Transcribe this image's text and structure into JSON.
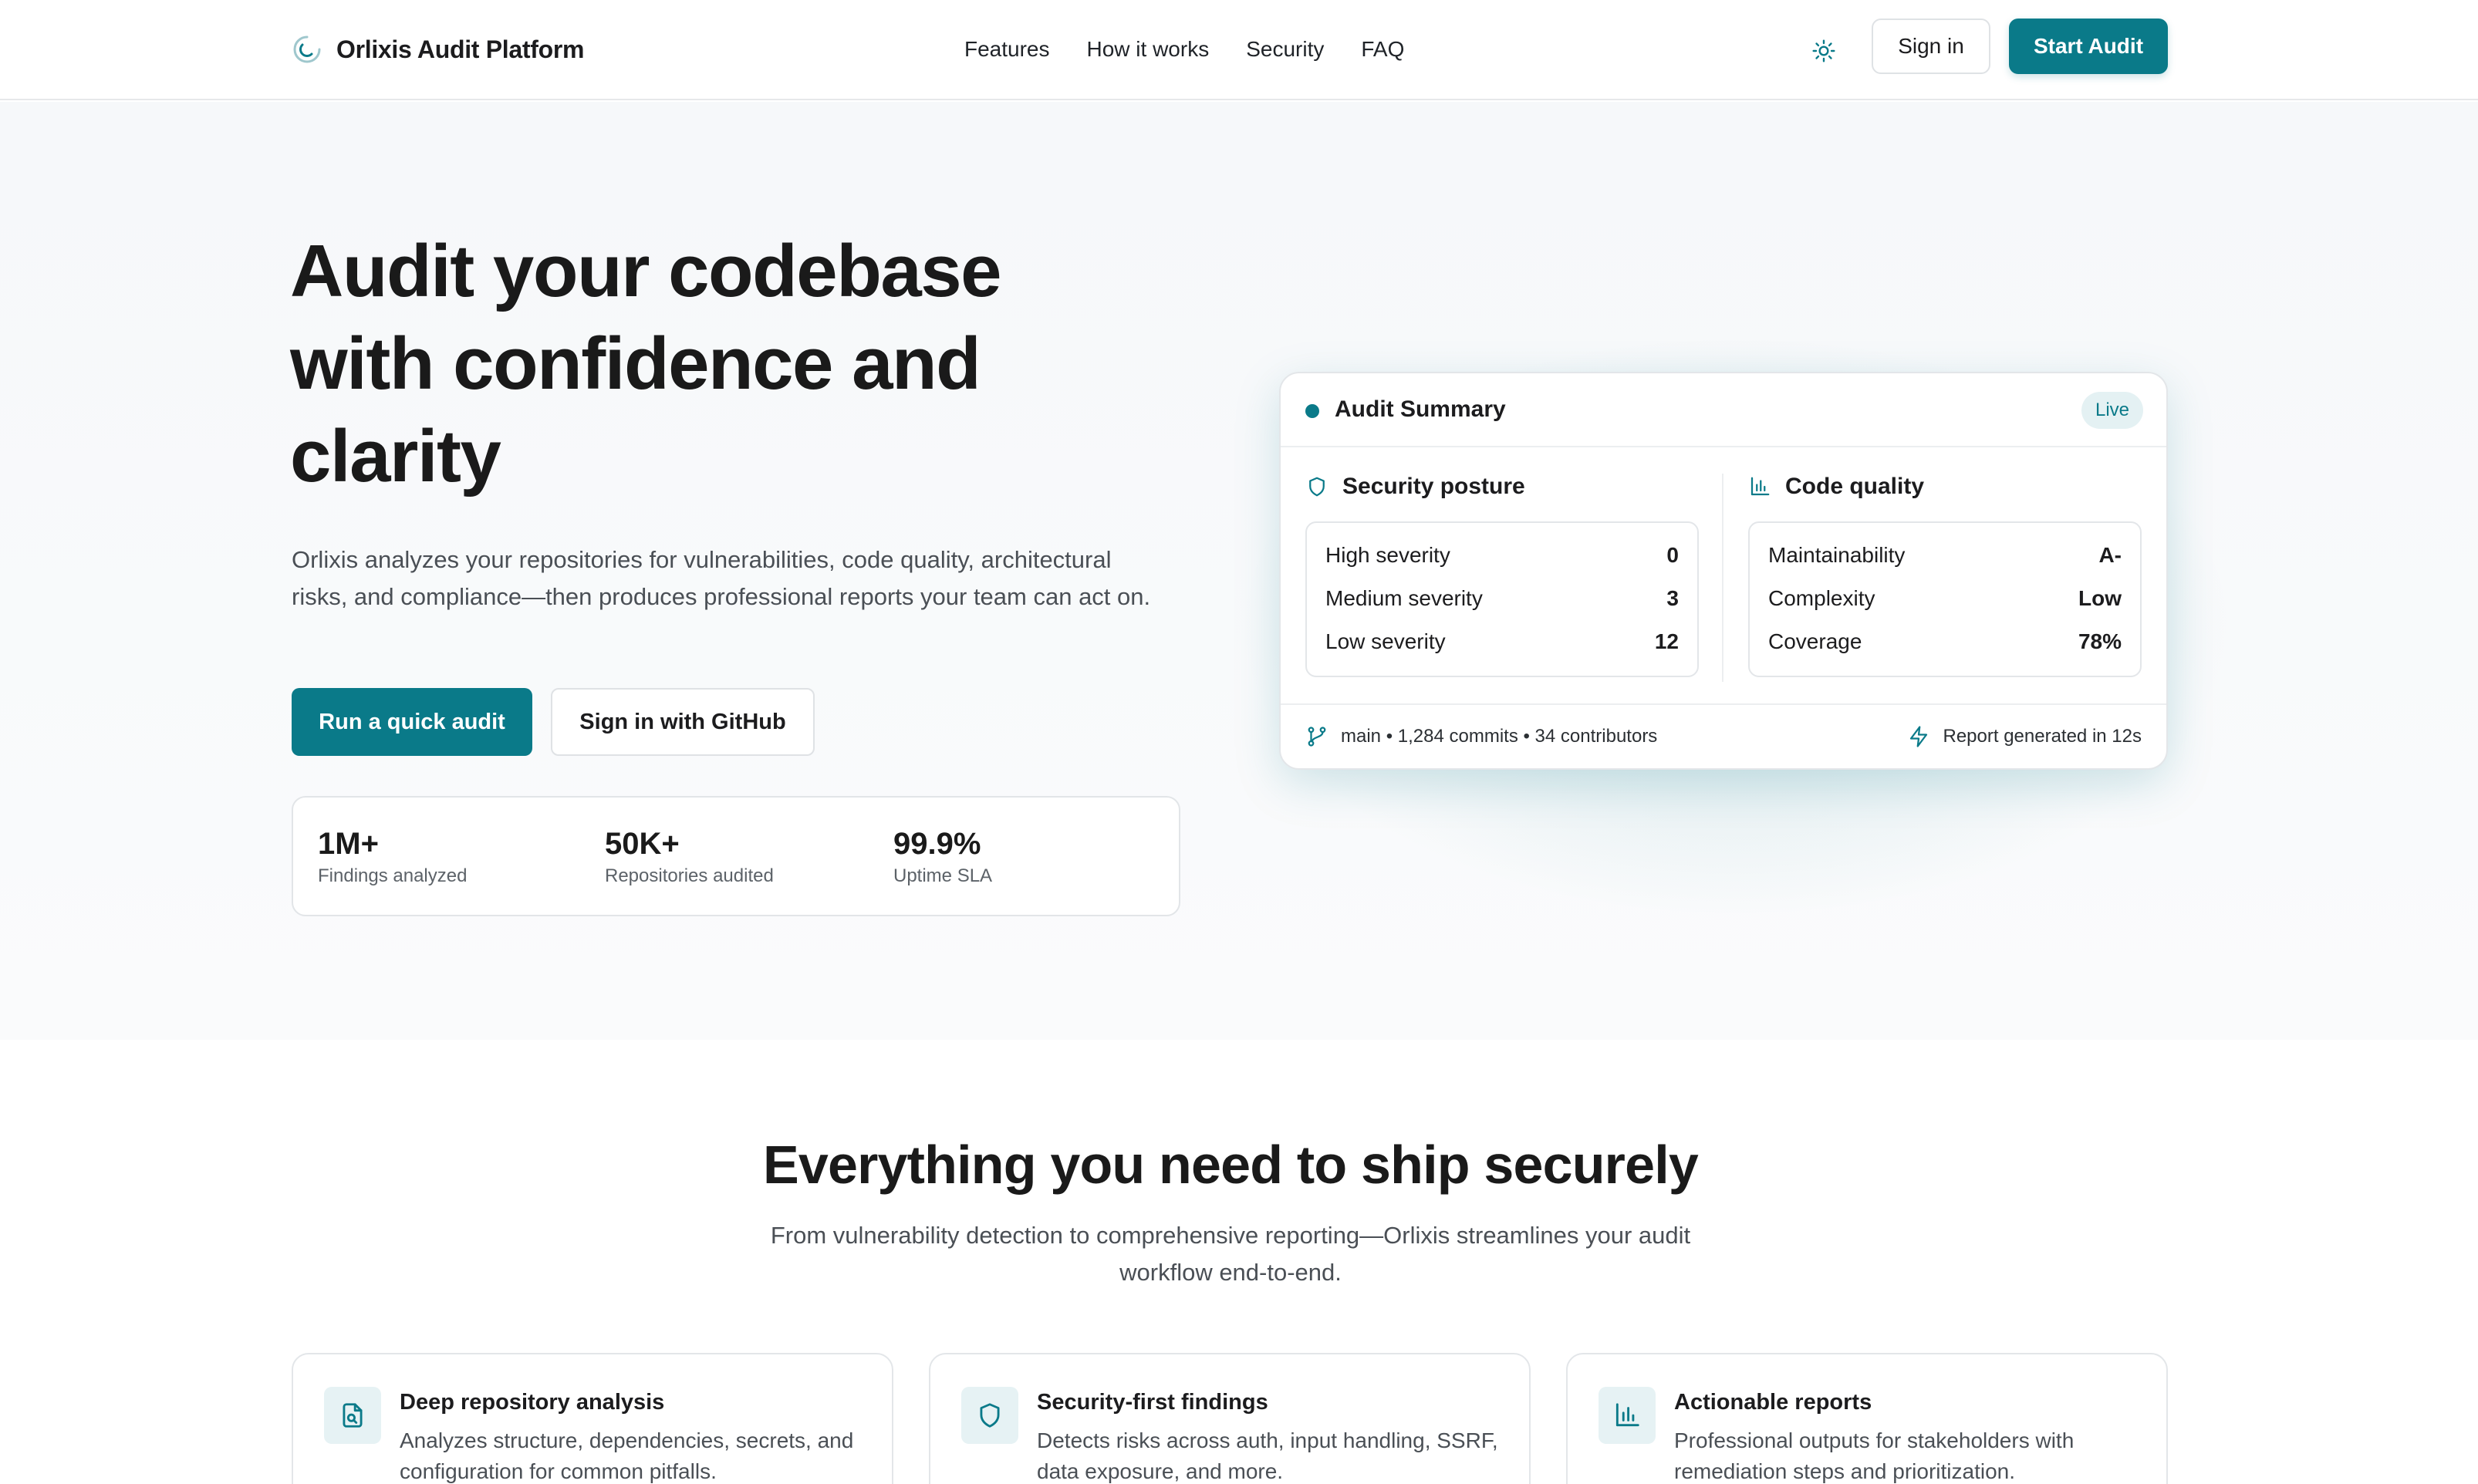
{
  "header": {
    "brand_name": "Orlixis Audit Platform",
    "brand_icon": "orlixis-logo-icon",
    "nav": [
      {
        "label": "Features"
      },
      {
        "label": "How it works"
      },
      {
        "label": "Security"
      },
      {
        "label": "FAQ"
      }
    ],
    "theme_icon": "sun-icon",
    "signin_label": "Sign in",
    "start_label": "Start Audit"
  },
  "hero": {
    "title": "Audit your codebase with confidence and clarity",
    "description": "Orlixis analyzes your repositories for vulnerabilities, code quality, architectural risks, and compliance—then produces professional reports your team can act on.",
    "primary_cta": "Run a quick audit",
    "secondary_cta": "Sign in with GitHub",
    "stats": [
      {
        "value": "1M+",
        "label": "Findings analyzed"
      },
      {
        "value": "50K+",
        "label": "Repositories audited"
      },
      {
        "value": "99.9%",
        "label": "Uptime SLA"
      }
    ]
  },
  "audit_card": {
    "title": "Audit Summary",
    "badge": "Live",
    "security": {
      "title": "Security posture",
      "icon": "shield-icon",
      "rows": [
        {
          "label": "High severity",
          "value": "0"
        },
        {
          "label": "Medium severity",
          "value": "3"
        },
        {
          "label": "Low severity",
          "value": "12"
        }
      ]
    },
    "quality": {
      "title": "Code quality",
      "icon": "bar-chart-icon",
      "rows": [
        {
          "label": "Maintainability",
          "value": "A-"
        },
        {
          "label": "Complexity",
          "value": "Low"
        },
        {
          "label": "Coverage",
          "value": "78%"
        }
      ]
    },
    "footer_left": "main • 1,284 commits • 34 contributors",
    "footer_right": "Report generated in 12s",
    "branch_icon": "git-branch-icon",
    "bolt_icon": "lightning-icon"
  },
  "features": {
    "title": "Everything you need to ship securely",
    "subtitle": "From vulnerability detection to comprehensive reporting—Orlixis streamlines your audit workflow end-to-end.",
    "cards": [
      {
        "title": "Deep repository analysis",
        "description": "Analyzes structure, dependencies, secrets, and configuration for common pitfalls.",
        "icon": "file-search-icon"
      },
      {
        "title": "Security-first findings",
        "description": "Detects risks across auth, input handling, SSRF, data exposure, and more.",
        "icon": "shield-icon"
      },
      {
        "title": "Actionable reports",
        "description": "Professional outputs for stakeholders with remediation steps and prioritization.",
        "icon": "bar-chart-icon"
      }
    ]
  },
  "colors": {
    "accent": "#0a7a89",
    "accent_light": "#e4f1f3",
    "text": "#1c1c1e",
    "muted": "#4a4f55",
    "border": "#e3e6e9"
  }
}
